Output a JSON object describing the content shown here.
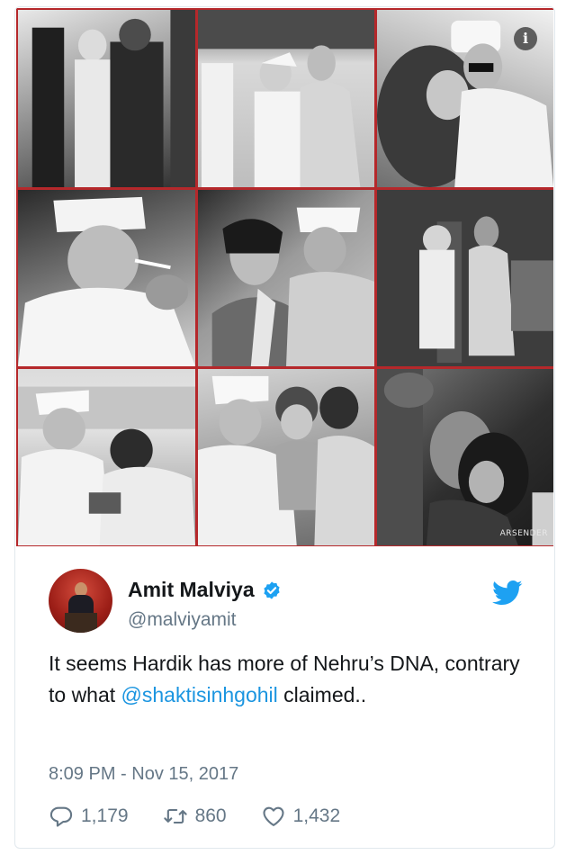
{
  "collage": {
    "photos": [
      {
        "name": "photo-1"
      },
      {
        "name": "photo-2"
      },
      {
        "name": "photo-3"
      },
      {
        "name": "photo-4"
      },
      {
        "name": "photo-5"
      },
      {
        "name": "photo-6"
      },
      {
        "name": "photo-7"
      },
      {
        "name": "photo-8"
      },
      {
        "name": "photo-9"
      }
    ],
    "border_color": "#b5282b",
    "info_icon": "info-icon",
    "watermark": "ARSENDER"
  },
  "tweet": {
    "display_name": "Amit Malviya",
    "verified_icon": "verified-badge-icon",
    "handle": "@malviyamit",
    "brand_icon": "twitter-bird-icon",
    "brand_color": "#1da1f2",
    "text_before": "It seems Hardik has more of Nehru’s DNA, contrary to what ",
    "mention": "@shaktisinhgohil",
    "text_after": " claimed..",
    "mention_color": "#1b95e0",
    "timestamp": "8:09 PM - Nov 15, 2017",
    "actions": {
      "replies": "1,179",
      "retweets": "860",
      "likes": "1,432"
    }
  }
}
